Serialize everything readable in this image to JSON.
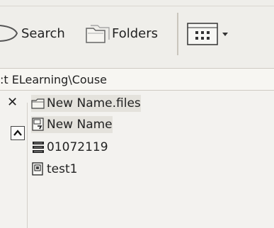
{
  "toolbar": {
    "search_label": "Search",
    "folders_label": "Folders"
  },
  "address": {
    "path": ":t ELearning\\Couse"
  },
  "files": [
    {
      "name": "New Name.files",
      "icon": "folder-icon"
    },
    {
      "name": "New Name",
      "icon": "web-page-icon"
    },
    {
      "name": "01072119",
      "icon": "stack-icon"
    },
    {
      "name": "test1",
      "icon": "document-icon"
    }
  ]
}
